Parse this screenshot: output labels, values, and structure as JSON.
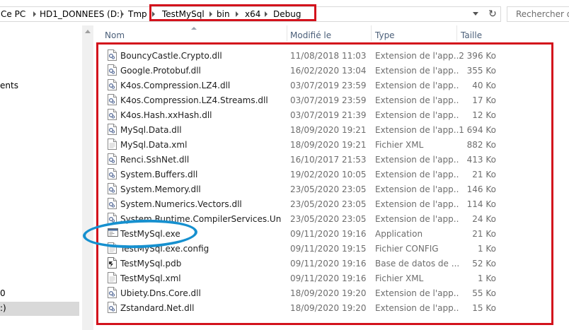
{
  "address": {
    "crumbs": [
      "Ce PC",
      "HD1_DONNEES (D:)",
      "Tmp",
      "TestMySql",
      "bin",
      "x64",
      "Debug"
    ],
    "refresh_icon": "refresh-icon",
    "search_placeholder": "Rechercher dans"
  },
  "nav": {
    "items": [
      "ents",
      "0",
      ":)"
    ],
    "selected_index": 2
  },
  "columns": {
    "name": "Nom",
    "modified": "Modifié le",
    "type": "Type",
    "size": "Taille"
  },
  "files": [
    {
      "name": "BouncyCastle.Crypto.dll",
      "modified": "11/08/2018 11:03",
      "type": "Extension de l'app...",
      "size": "2 396 Ko",
      "icon": "dll-icon"
    },
    {
      "name": "Google.Protobuf.dll",
      "modified": "16/02/2020 13:04",
      "type": "Extension de l'app...",
      "size": "355 Ko",
      "icon": "dll-icon"
    },
    {
      "name": "K4os.Compression.LZ4.dll",
      "modified": "03/07/2019 23:59",
      "type": "Extension de l'app...",
      "size": "40 Ko",
      "icon": "dll-icon"
    },
    {
      "name": "K4os.Compression.LZ4.Streams.dll",
      "modified": "03/07/2019 23:59",
      "type": "Extension de l'app...",
      "size": "17 Ko",
      "icon": "dll-icon"
    },
    {
      "name": "K4os.Hash.xxHash.dll",
      "modified": "03/07/2019 21:39",
      "type": "Extension de l'app...",
      "size": "12 Ko",
      "icon": "dll-icon"
    },
    {
      "name": "MySql.Data.dll",
      "modified": "18/09/2020 19:21",
      "type": "Extension de l'app...",
      "size": "1 694 Ko",
      "icon": "dll-icon"
    },
    {
      "name": "MySql.Data.xml",
      "modified": "18/09/2020 19:21",
      "type": "Fichier XML",
      "size": "882 Ko",
      "icon": "file-icon"
    },
    {
      "name": "Renci.SshNet.dll",
      "modified": "16/10/2017 21:53",
      "type": "Extension de l'app...",
      "size": "413 Ko",
      "icon": "dll-icon"
    },
    {
      "name": "System.Buffers.dll",
      "modified": "19/02/2020 10:05",
      "type": "Extension de l'app...",
      "size": "21 Ko",
      "icon": "dll-icon"
    },
    {
      "name": "System.Memory.dll",
      "modified": "23/05/2020 23:05",
      "type": "Extension de l'app...",
      "size": "146 Ko",
      "icon": "dll-icon"
    },
    {
      "name": "System.Numerics.Vectors.dll",
      "modified": "23/05/2020 23:05",
      "type": "Extension de l'app...",
      "size": "114 Ko",
      "icon": "dll-icon"
    },
    {
      "name": "System.Runtime.CompilerServices.Unsaf...",
      "modified": "23/05/2020 23:05",
      "type": "Extension de l'app...",
      "size": "24 Ko",
      "icon": "dll-icon"
    },
    {
      "name": "TestMySql.exe",
      "modified": "09/11/2020 19:16",
      "type": "Application",
      "size": "21 Ko",
      "icon": "exe-icon"
    },
    {
      "name": "TestMySql.exe.config",
      "modified": "09/11/2020 19:15",
      "type": "Fichier CONFIG",
      "size": "1 Ko",
      "icon": "file-icon"
    },
    {
      "name": "TestMySql.pdb",
      "modified": "09/11/2020 19:16",
      "type": "Base de datos de ...",
      "size": "52 Ko",
      "icon": "pdb-icon"
    },
    {
      "name": "TestMySql.xml",
      "modified": "09/11/2020 19:16",
      "type": "Fichier XML",
      "size": "1 Ko",
      "icon": "file-icon"
    },
    {
      "name": "Ubiety.Dns.Core.dll",
      "modified": "18/09/2020 19:20",
      "type": "Extension de l'app...",
      "size": "55 Ko",
      "icon": "dll-icon"
    },
    {
      "name": "Zstandard.Net.dll",
      "modified": "18/09/2020 19:20",
      "type": "Extension de l'app...",
      "size": "15 Ko",
      "icon": "dll-icon"
    }
  ],
  "annotations": {
    "highlight_color": "#d3121c",
    "circle_color": "#1690cf"
  }
}
